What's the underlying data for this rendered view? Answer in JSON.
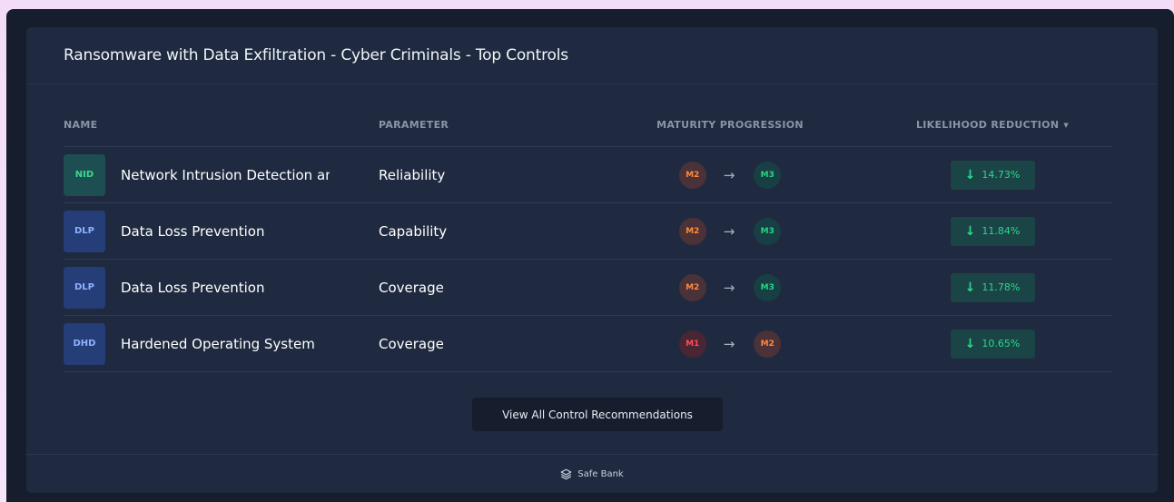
{
  "card": {
    "title": "Ransomware with Data Exfiltration - Cyber Criminals - Top Controls"
  },
  "table": {
    "headers": {
      "name": "NAME",
      "parameter": "PARAMETER",
      "maturity": "MATURITY PROGRESSION",
      "likelihood": "LIKELIHOOD REDUCTION"
    },
    "sort_icon": "caret-down-icon",
    "rows": [
      {
        "code": "NID",
        "name": "Network Intrusion Detection and",
        "parameter": "Reliability",
        "from": "M2",
        "to": "M3",
        "reduction": "14.73%"
      },
      {
        "code": "DLP",
        "name": "Data Loss Prevention",
        "parameter": "Capability",
        "from": "M2",
        "to": "M3",
        "reduction": "11.84%"
      },
      {
        "code": "DLP",
        "name": "Data Loss Prevention",
        "parameter": "Coverage",
        "from": "M2",
        "to": "M3",
        "reduction": "11.78%"
      },
      {
        "code": "DHD",
        "name": "Hardened Operating System",
        "parameter": "Coverage",
        "from": "M1",
        "to": "M2",
        "reduction": "10.65%"
      }
    ]
  },
  "view_all_button": {
    "label": "View All Control Recommendations"
  },
  "footer": {
    "brand": "Safe Bank",
    "icon": "layers-icon"
  },
  "colors": {
    "accent_green": "#2bd98a",
    "m1": "#ff4d5a",
    "m2": "#ff8a3d",
    "m3": "#27d584",
    "card_bg": "#1f2a40"
  }
}
